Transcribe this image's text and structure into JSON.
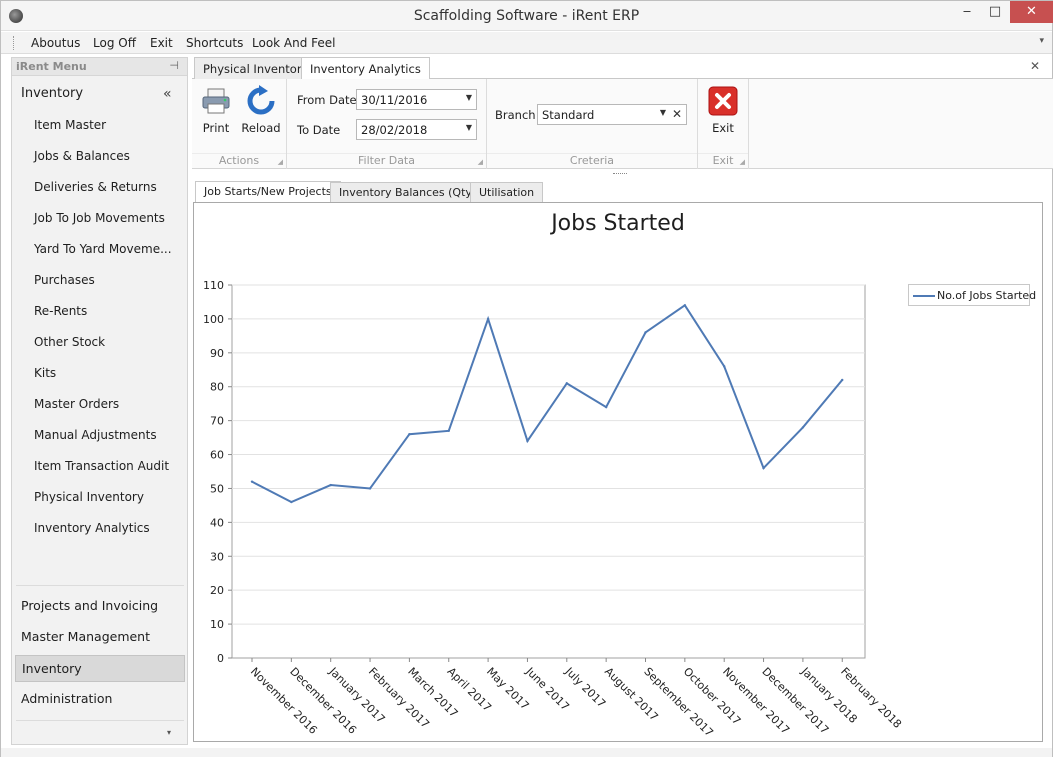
{
  "window": {
    "title": "Scaffolding Software - iRent ERP",
    "min": "‒",
    "max": "□",
    "close": "✕"
  },
  "menubar": {
    "items": [
      "Aboutus",
      "Log Off",
      "Exit",
      "Shortcuts",
      "Look And Feel"
    ],
    "overflow": "▾"
  },
  "sidebar": {
    "header": "iRent Menu",
    "pin": "⊣",
    "group": "Inventory",
    "collapse": "«",
    "items": [
      "Item Master",
      "Jobs & Balances",
      "Deliveries & Returns",
      "Job To Job Movements",
      "Yard To Yard Moveme...",
      "Purchases",
      "Re-Rents",
      "Other Stock",
      "Kits",
      "Master Orders",
      "Manual Adjustments",
      "Item Transaction Audit",
      "Physical Inventory",
      "Inventory Analytics"
    ],
    "bottom_groups": [
      "Projects and Invoicing",
      "Master Management",
      "Inventory",
      "Administration"
    ],
    "down": "▾"
  },
  "doc_tabs": {
    "tabs": [
      "Physical Inventory",
      "Inventory Analytics"
    ],
    "close": "✕"
  },
  "ribbon": {
    "actions": {
      "print": "Print",
      "reload": "Reload",
      "label": "Actions"
    },
    "filter": {
      "from_label": "From Date",
      "from_value": "30/11/2016",
      "to_label": "To Date",
      "to_value": "28/02/2018",
      "label": "Filter Data"
    },
    "criteria": {
      "branch_label": "Branch",
      "branch_value": "Standard",
      "label": "Creteria"
    },
    "exit": {
      "exit": "Exit",
      "label": "Exit"
    },
    "corner": "◢",
    "arrow": "▼",
    "clear": "✕"
  },
  "inner_tabs": [
    "Job Starts/New Projects",
    "Inventory Balances (Qty)",
    "Utilisation"
  ],
  "colors": {
    "series": "#4f7ab5",
    "accent": "#c0392b"
  },
  "chart_data": {
    "type": "line",
    "title": "Jobs Started",
    "xlabel": "",
    "ylabel": "",
    "categories": [
      "November 2016",
      "December 2016",
      "January 2017",
      "February 2017",
      "March 2017",
      "April 2017",
      "May 2017",
      "June 2017",
      "July 2017",
      "August 2017",
      "September 2017",
      "October 2017",
      "November 2017",
      "December 2017",
      "January 2018",
      "February 2018"
    ],
    "series": [
      {
        "name": "No.of Jobs Started",
        "values": [
          52,
          46,
          51,
          50,
          66,
          67,
          100,
          64,
          81,
          74,
          96,
          104,
          86,
          56,
          68,
          82
        ]
      }
    ],
    "ylim": [
      0,
      110
    ],
    "yticks": [
      0,
      10,
      20,
      30,
      40,
      50,
      60,
      70,
      80,
      90,
      100,
      110
    ],
    "grid": true,
    "legend": "top-right"
  }
}
